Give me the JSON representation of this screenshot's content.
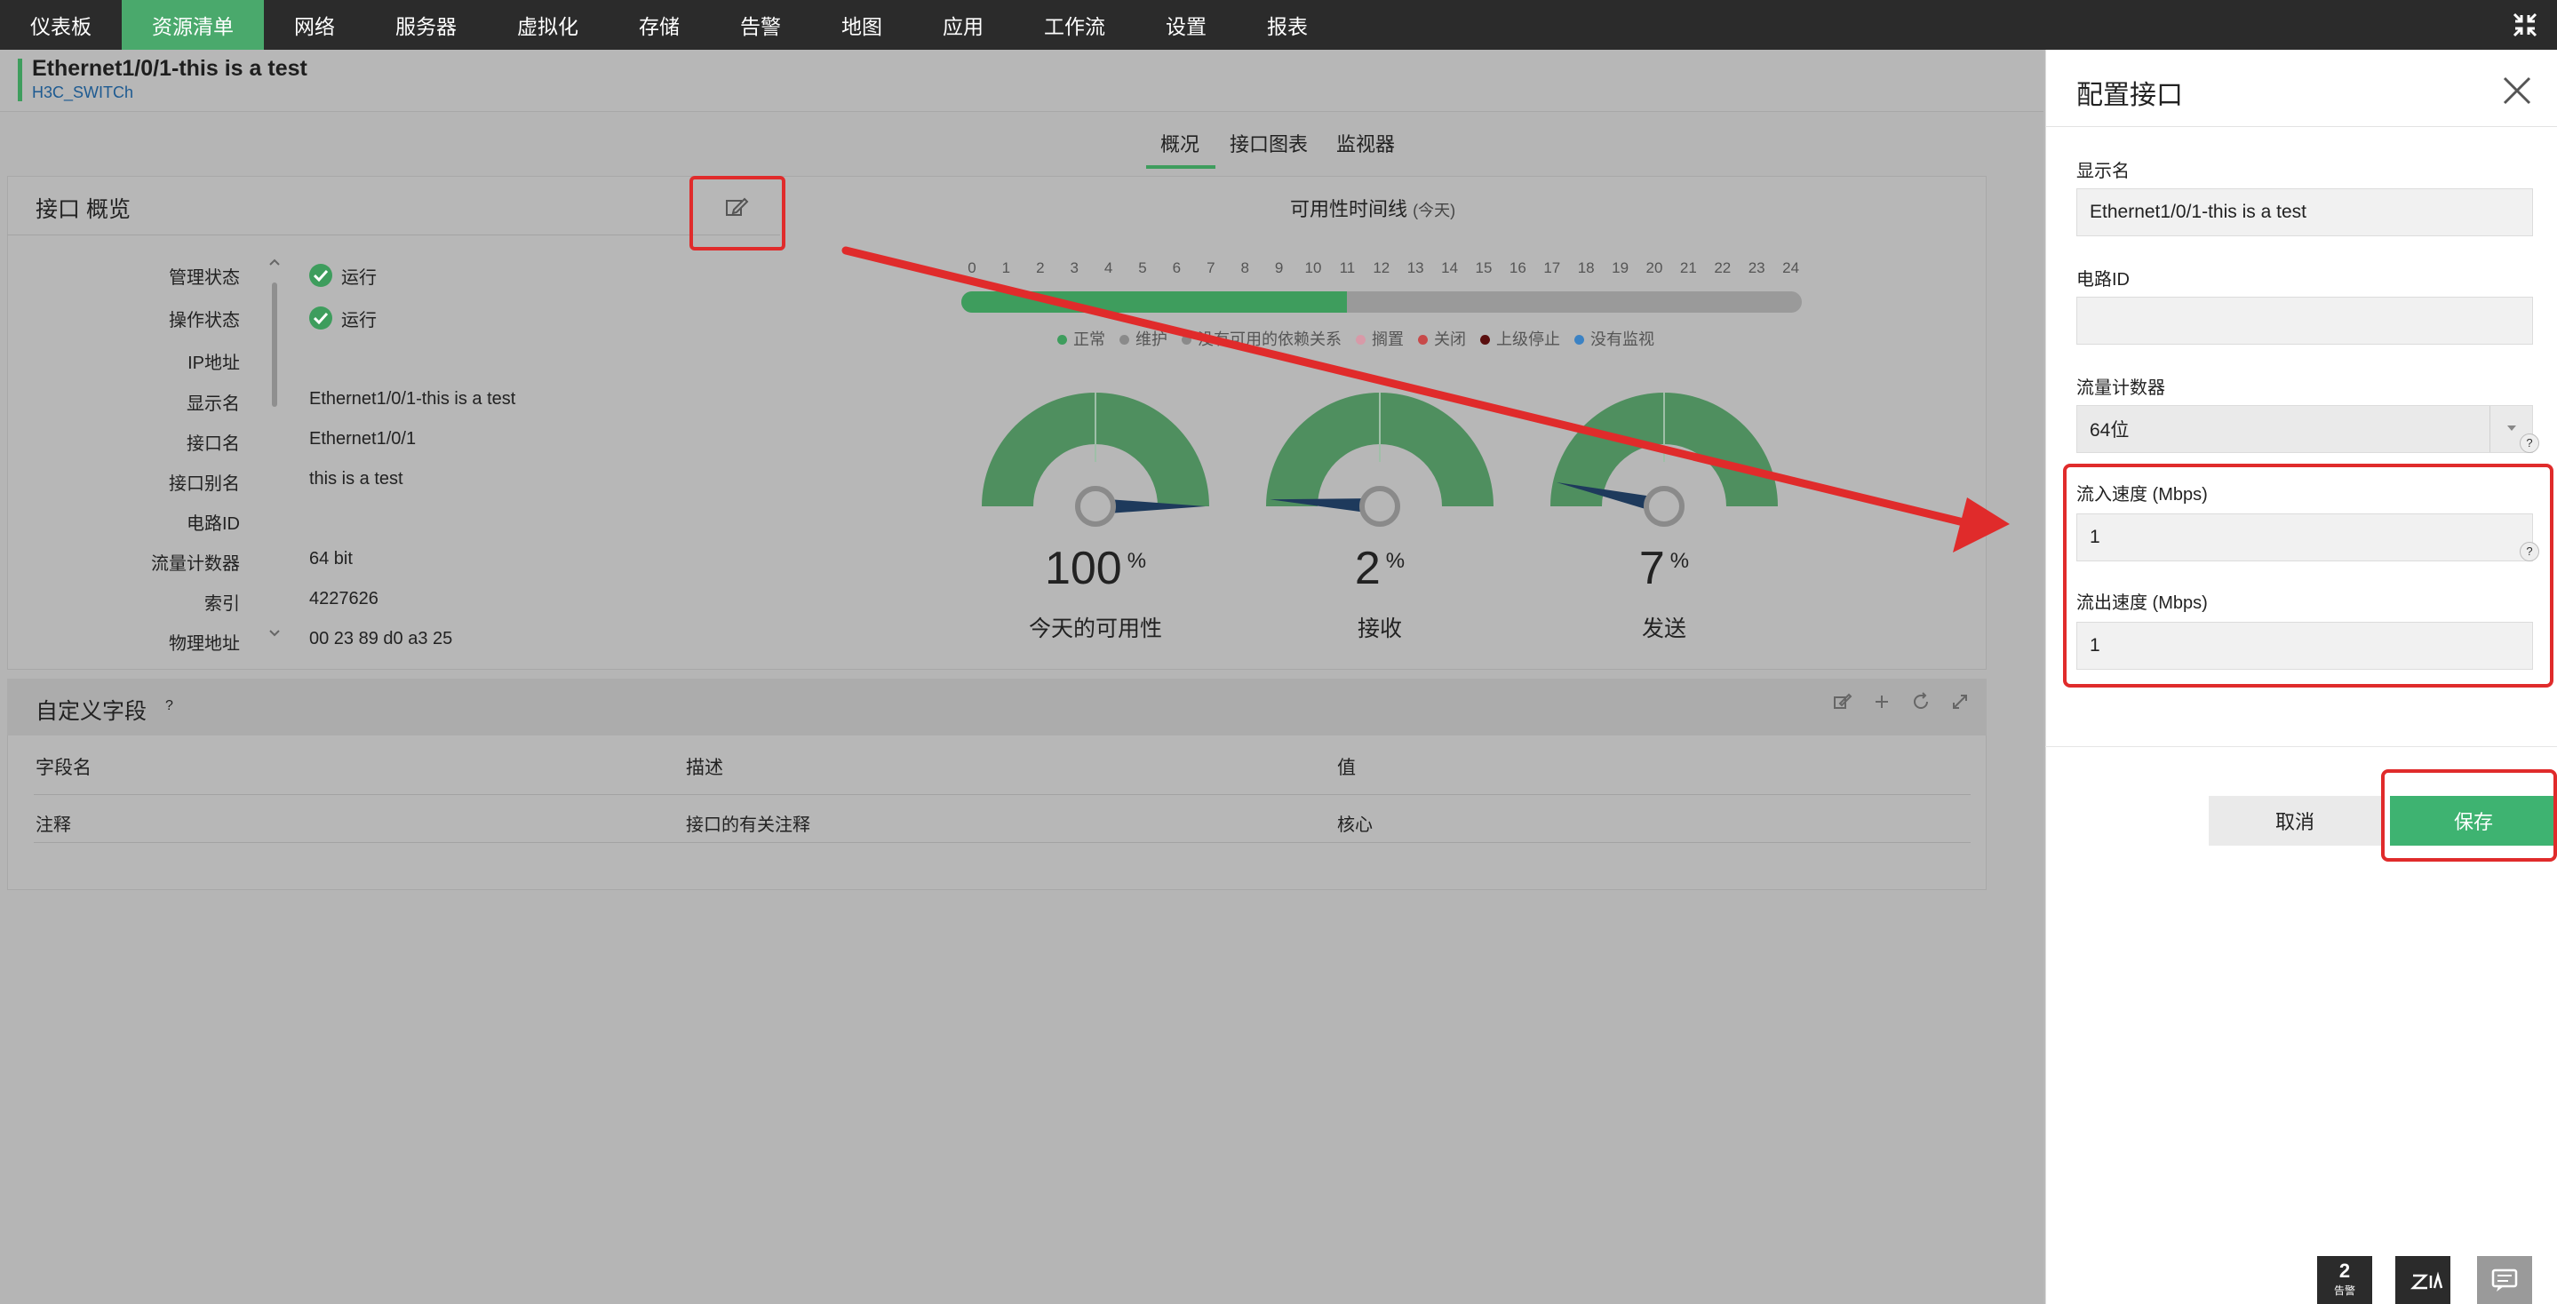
{
  "nav": {
    "items": [
      "仪表板",
      "资源清单",
      "网络",
      "服务器",
      "虚拟化",
      "存储",
      "告警",
      "地图",
      "应用",
      "工作流",
      "设置",
      "报表"
    ],
    "active_index": 1
  },
  "header": {
    "title": "Ethernet1/0/1-this is a test",
    "subtitle": "H3C_SWITCh"
  },
  "tabs": [
    "概况",
    "接口图表",
    "监视器"
  ],
  "overview": {
    "title": "接口 概览",
    "rows": [
      {
        "label": "管理状态",
        "value": "运行",
        "ok": true
      },
      {
        "label": "操作状态",
        "value": "运行",
        "ok": true
      },
      {
        "label": "IP地址",
        "value": ""
      },
      {
        "label": "显示名",
        "value": "Ethernet1/0/1-this is a test"
      },
      {
        "label": "接口名",
        "value": "Ethernet1/0/1"
      },
      {
        "label": "接口别名",
        "value": "this is a test"
      },
      {
        "label": "电路ID",
        "value": ""
      },
      {
        "label": "流量计数器",
        "value": "64 bit"
      },
      {
        "label": "索引",
        "value": "4227626"
      },
      {
        "label": "物理地址",
        "value": "00 23 89 d0 a3 25"
      }
    ]
  },
  "timeline": {
    "title": "可用性时间线",
    "period": "(今天)",
    "hours": [
      "0",
      "1",
      "2",
      "3",
      "4",
      "5",
      "6",
      "7",
      "8",
      "9",
      "10",
      "11",
      "12",
      "13",
      "14",
      "15",
      "16",
      "17",
      "18",
      "19",
      "20",
      "21",
      "22",
      "23",
      "24"
    ],
    "up_fraction": 0.4583,
    "legend": [
      {
        "label": "正常",
        "color": "#3e9d5d"
      },
      {
        "label": "维护",
        "color": "#8a8a8a"
      },
      {
        "label": "没有可用的依赖关系",
        "color": "#8a8a8a"
      },
      {
        "label": "搁置",
        "color": "#d89aa8"
      },
      {
        "label": "关闭",
        "color": "#c84a4a"
      },
      {
        "label": "上级停止",
        "color": "#5a0f0f"
      },
      {
        "label": "没有监视",
        "color": "#3b82c4"
      }
    ]
  },
  "gauges": [
    {
      "value": "100",
      "unit": "%",
      "caption": "今天的可用性",
      "percent": 100
    },
    {
      "value": "2",
      "unit": "%",
      "caption": "接收",
      "percent": 2
    },
    {
      "value": "7",
      "unit": "%",
      "caption": "发送",
      "percent": 7
    }
  ],
  "custom_fields": {
    "title": "自定义字段",
    "help": "?",
    "columns": [
      "字段名",
      "描述",
      "值"
    ],
    "rows": [
      [
        "注释",
        "接口的有关注释",
        "核心"
      ]
    ]
  },
  "drawer": {
    "title": "配置接口",
    "display_name_label": "显示名",
    "display_name_value": "Ethernet1/0/1-this is a test",
    "circuit_label": "电路ID",
    "circuit_value": "",
    "counter_label": "流量计数器",
    "counter_value": "64位",
    "in_speed_label": "流入速度 (Mbps)",
    "in_speed_value": "1",
    "out_speed_label": "流出速度 (Mbps)",
    "out_speed_value": "1",
    "help": "?",
    "cancel": "取消",
    "save": "保存"
  },
  "dock": {
    "alarm_count": "2",
    "alarm_label": "告警"
  },
  "colors": {
    "accent": "#3e9d5d",
    "save": "#3eb371",
    "highlight": "#e02b2b",
    "nav_bg": "#2b2b2b",
    "needle": "#1e3a5c"
  }
}
